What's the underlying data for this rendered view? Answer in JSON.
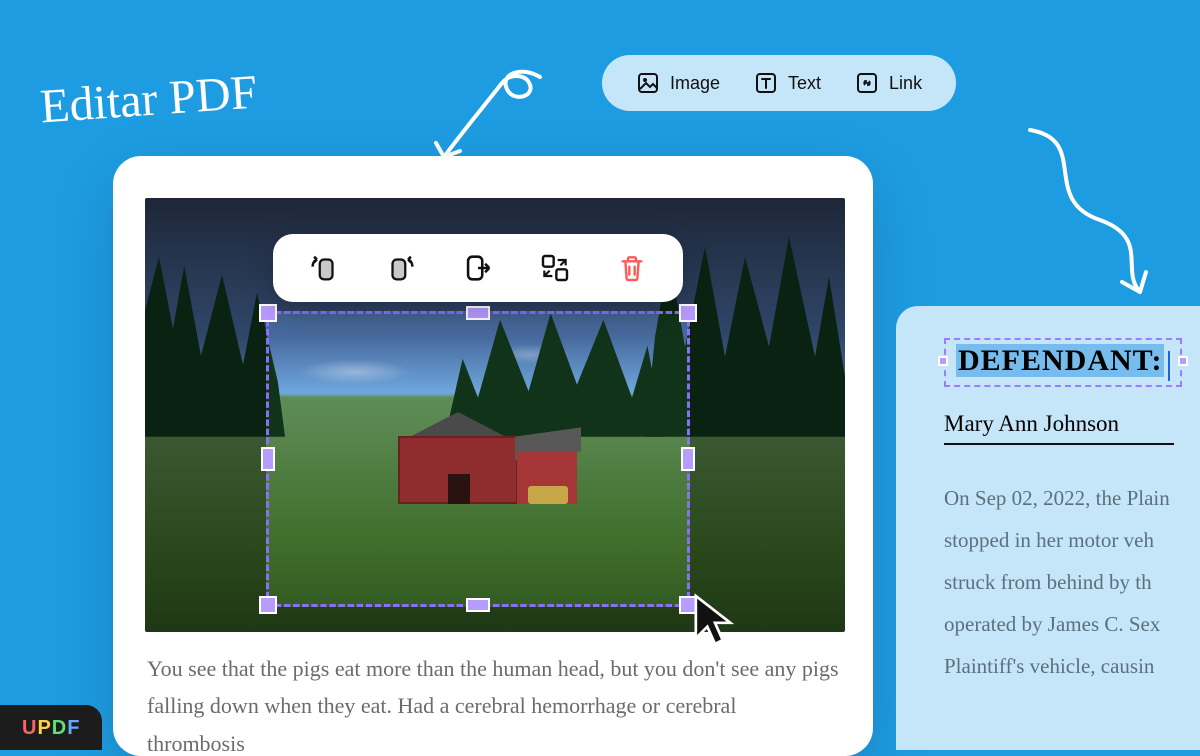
{
  "title": "Editar PDF",
  "toolbar": {
    "image": "Image",
    "text": "Text",
    "link": "Link"
  },
  "image_tools": {
    "rotate_left": "rotate-left",
    "rotate_right": "rotate-right",
    "extract": "extract",
    "replace": "replace",
    "delete": "delete"
  },
  "document": {
    "body_text": "You see that the pigs eat more than the human head, but you don't see any pigs falling down when they eat. Had a cerebral hemorrhage or cerebral thrombosis"
  },
  "side_doc": {
    "selected_label": "DEFENDANT:",
    "name": "Mary Ann Johnson",
    "body": "On Sep 02, 2022, the Plain\nstopped in her motor veh\nstruck from behind by th\noperated by James C. Sex\nPlaintiff's vehicle, causin"
  },
  "brand": "UPDF"
}
